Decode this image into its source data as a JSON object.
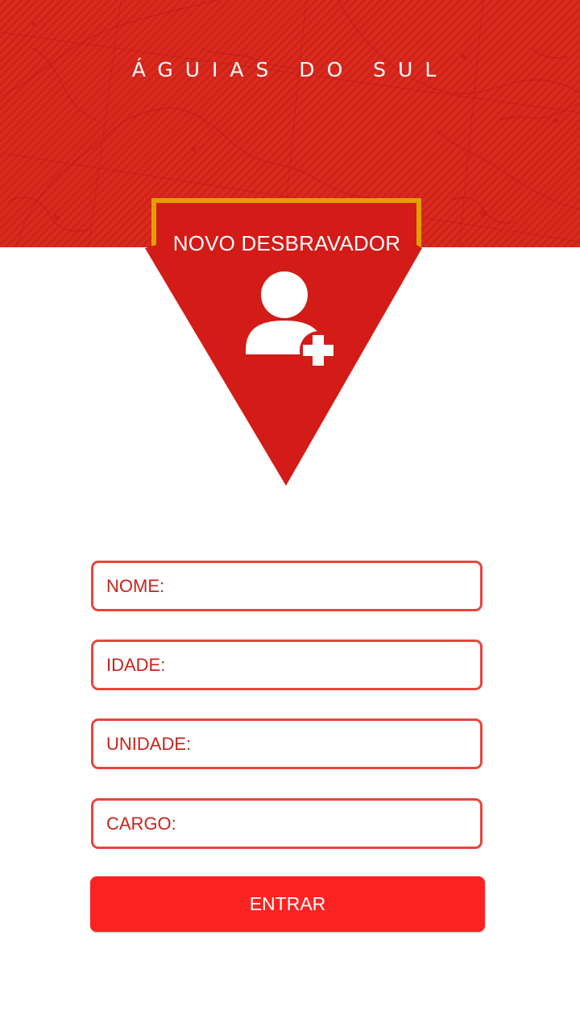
{
  "app": {
    "title": "ÁGUIAS DO SUL"
  },
  "pennant": {
    "title": "NOVO DESBRAVADOR",
    "icon": "user-add-icon"
  },
  "form": {
    "fields": [
      {
        "label": "NOME:",
        "value": ""
      },
      {
        "label": "IDADE:",
        "value": ""
      },
      {
        "label": "UNIDADE:",
        "value": ""
      },
      {
        "label": "CARGO:",
        "value": ""
      }
    ],
    "submit_label": "ENTRAR"
  },
  "colors": {
    "header_red": "#d92419",
    "pennant_red": "#d31b17",
    "pennant_trim": "#e0a000",
    "field_border": "#e8453c",
    "label_red": "#c8231b",
    "button_red": "#fd2222"
  }
}
